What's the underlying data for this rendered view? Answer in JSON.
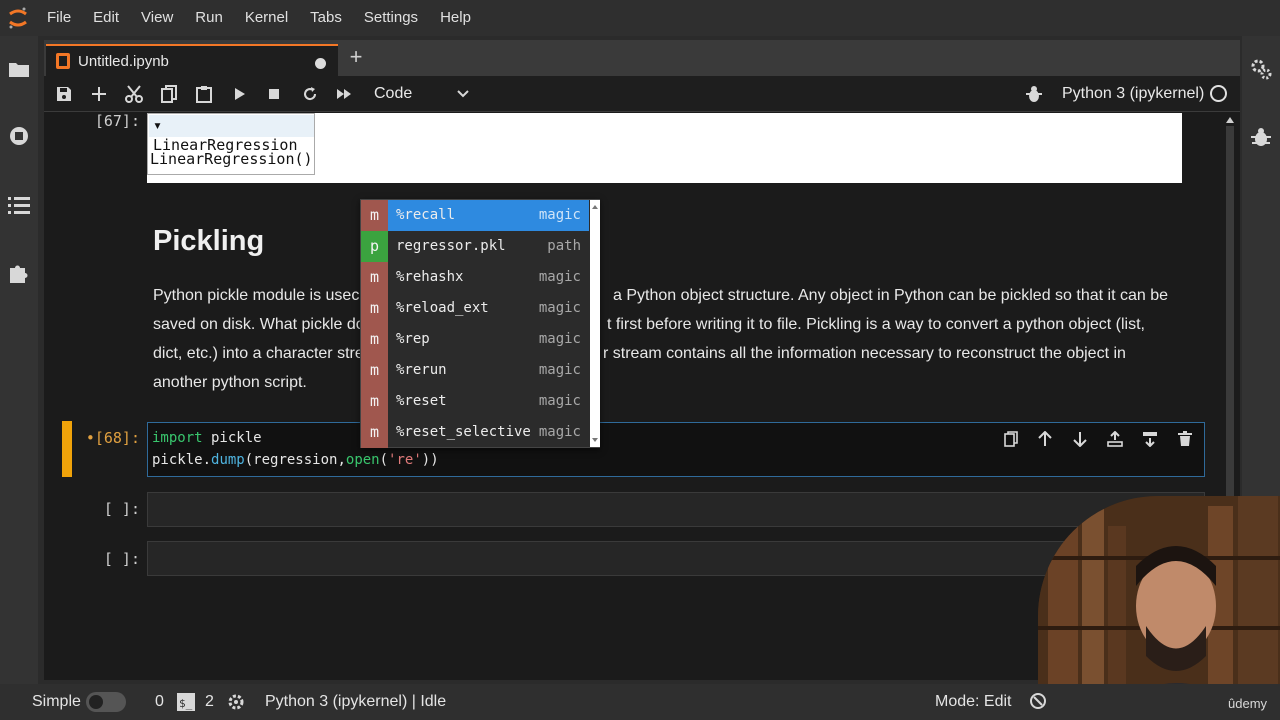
{
  "menubar": {
    "items": [
      "File",
      "Edit",
      "View",
      "Run",
      "Kernel",
      "Tabs",
      "Settings",
      "Help"
    ]
  },
  "tab": {
    "label": "Untitled.ipynb",
    "new_tab": "+"
  },
  "toolbar": {
    "cell_type": "Code",
    "kernel": "Python 3 (ipykernel)"
  },
  "cells": {
    "out67_prompt": "[67]:",
    "out67_head": "▾ LinearRegression",
    "out67_body": "LinearRegression()",
    "markdown": {
      "title": "Pickling",
      "lines": [
        "Python pickle module is usec",
        "saved on disk. What pickle do",
        "dict, etc.) into a character stre",
        "another python script.",
        "a Python object structure. Any object in Python can be pickled so that it can be",
        "t first before writing it to file. Pickling is a way to convert a python object (list,",
        "r stream contains all the information necessary to reconstruct the object in"
      ]
    },
    "in68_prompt": "•[68]:",
    "code": {
      "l1_kw": "import",
      "l1_rest": " pickle",
      "l2_a": "pickle.",
      "l2_fn": "dump",
      "l2_b": "(regression,",
      "l2_fn2": "open",
      "l2_c": "(",
      "l2_str": "'re'",
      "l2_d": "))"
    },
    "empty_prompt_1": "[ ]:",
    "empty_prompt_2": "[ ]:"
  },
  "completer": {
    "items": [
      {
        "type": "m",
        "text": "%recall",
        "kind": "magic"
      },
      {
        "type": "p",
        "text": "regressor.pkl",
        "kind": "path"
      },
      {
        "type": "m",
        "text": "%rehashx",
        "kind": "magic"
      },
      {
        "type": "m",
        "text": "%reload_ext",
        "kind": "magic"
      },
      {
        "type": "m",
        "text": "%rep",
        "kind": "magic"
      },
      {
        "type": "m",
        "text": "%rerun",
        "kind": "magic"
      },
      {
        "type": "m",
        "text": "%reset",
        "kind": "magic"
      },
      {
        "type": "m",
        "text": "%reset_selective",
        "kind": "magic"
      }
    ]
  },
  "statusbar": {
    "simple": "Simple",
    "terminals": "0",
    "kernels": "2",
    "kernel_status": "Python 3 (ipykernel) | Idle",
    "mode": "Mode: Edit"
  },
  "watermark": "ûdemy",
  "colors": {
    "accent": "#f37726",
    "selection": "#2e8ae0",
    "active_cell_bar": "#f0a30a",
    "magic_badge": "#a0574e",
    "path_badge": "#3ba33f"
  }
}
